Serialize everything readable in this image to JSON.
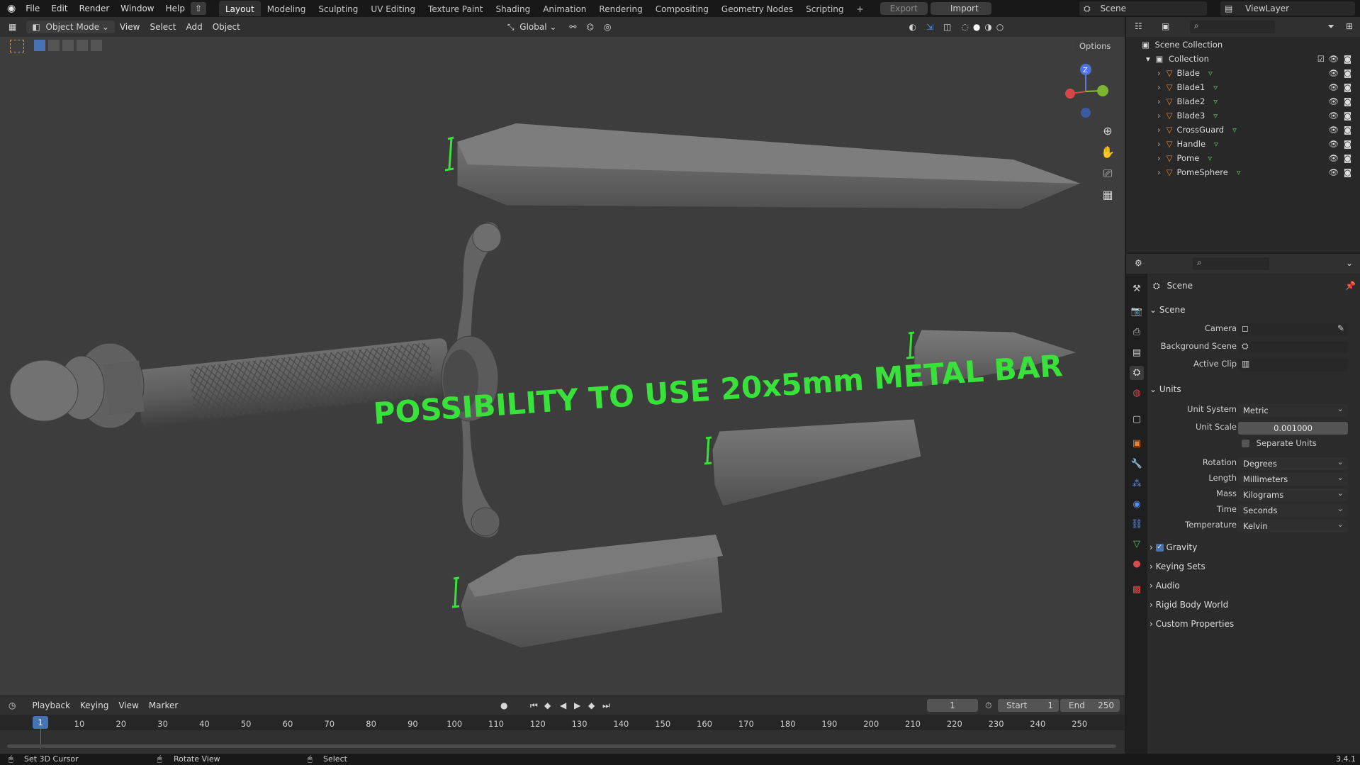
{
  "topbar": {
    "menus": [
      "File",
      "Edit",
      "Render",
      "Window",
      "Help"
    ],
    "workspaces": [
      "Layout",
      "Modeling",
      "Sculpting",
      "UV Editing",
      "Texture Paint",
      "Shading",
      "Animation",
      "Rendering",
      "Compositing",
      "Geometry Nodes",
      "Scripting"
    ],
    "active_workspace": "Layout",
    "export_label": "Export",
    "import_label": "Import",
    "scene_name": "Scene",
    "view_layer": "ViewLayer"
  },
  "viewport_header": {
    "mode": "Object Mode",
    "menus": [
      "View",
      "Select",
      "Add",
      "Object"
    ],
    "orientation": "Global",
    "options_label": "Options"
  },
  "viewport": {
    "annotation": "POSSIBILITY TO USE 20x5mm METAL BAR",
    "annotation_color": "#39e23a",
    "model_color": "#6a6a6a"
  },
  "outliner": {
    "root": "Scene Collection",
    "collection": "Collection",
    "objects": [
      "Blade",
      "Blade1",
      "Blade2",
      "Blade3",
      "CrossGuard",
      "Handle",
      "Pome",
      "PomeSphere"
    ]
  },
  "properties": {
    "context": "Scene",
    "panel_scene": "Scene",
    "camera_label": "Camera",
    "background_scene_label": "Background Scene",
    "active_clip_label": "Active Clip",
    "panel_units": "Units",
    "unit_system_label": "Unit System",
    "unit_system": "Metric",
    "unit_scale_label": "Unit Scale",
    "unit_scale": "0.001000",
    "separate_units_label": "Separate Units",
    "rotation_label": "Rotation",
    "rotation": "Degrees",
    "length_label": "Length",
    "length": "Millimeters",
    "mass_label": "Mass",
    "mass": "Kilograms",
    "time_label": "Time",
    "time": "Seconds",
    "temperature_label": "Temperature",
    "temperature": "Kelvin",
    "gravity_label": "Gravity",
    "collapsed_panels": [
      "Keying Sets",
      "Audio",
      "Rigid Body World",
      "Custom Properties"
    ]
  },
  "timeline": {
    "menus": [
      "Playback",
      "Keying",
      "View",
      "Marker"
    ],
    "current_frame": "1",
    "start_label": "Start",
    "start": "1",
    "end_label": "End",
    "end": "250",
    "ticks": [
      "10",
      "20",
      "30",
      "40",
      "50",
      "60",
      "70",
      "80",
      "90",
      "100",
      "110",
      "120",
      "130",
      "140",
      "150",
      "160",
      "170",
      "180",
      "190",
      "200",
      "210",
      "220",
      "230",
      "240",
      "250"
    ]
  },
  "statusbar": {
    "hint1": "Set 3D Cursor",
    "hint2": "Rotate View",
    "hint3": "Select",
    "version": "3.4.1"
  }
}
